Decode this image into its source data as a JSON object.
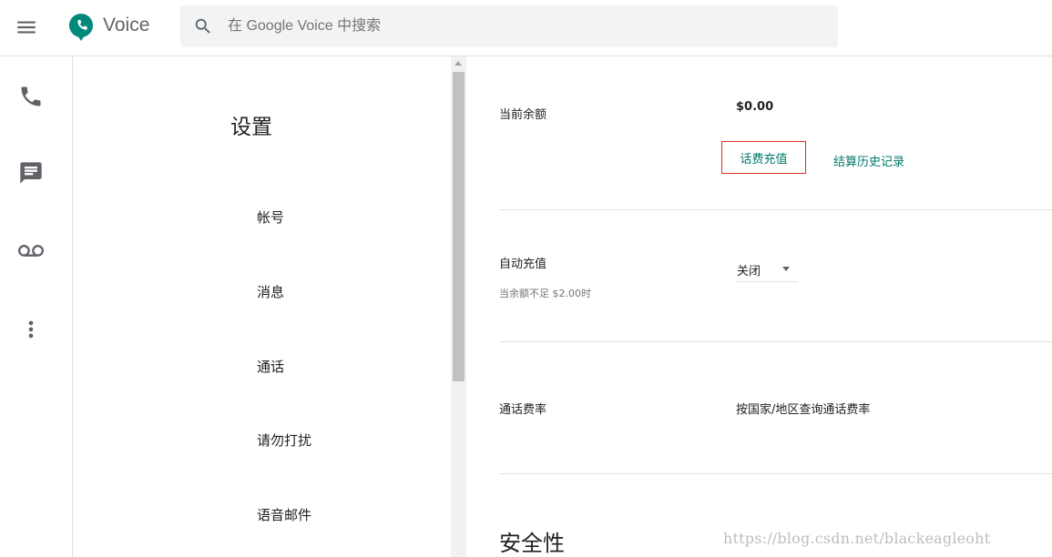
{
  "header": {
    "app_name": "Voice",
    "search_placeholder": "在 Google Voice 中搜索"
  },
  "rail": {
    "icons": [
      "phone-icon",
      "message-icon",
      "voicemail-icon",
      "more-vert-icon"
    ]
  },
  "settings": {
    "title": "设置",
    "nav_items": [
      "帐号",
      "消息",
      "通话",
      "请勿打扰",
      "语音邮件"
    ]
  },
  "billing": {
    "balance_label": "当前余额",
    "balance_value": "$0.00",
    "topup_label": "话费充值",
    "history_label": "结算历史记录",
    "auto_topup_label": "自动充值",
    "auto_topup_sub": "当余额不足 $2.00时",
    "auto_topup_value": "关闭",
    "rates_label": "通话费率",
    "rates_link": "按国家/地区查询通话费率"
  },
  "security": {
    "title": "安全性"
  },
  "watermark": "https://blog.csdn.net/blackeagleoht",
  "colors": {
    "accent": "#00796b",
    "highlight_border": "#d93025",
    "icon_gray": "#5f6368"
  }
}
